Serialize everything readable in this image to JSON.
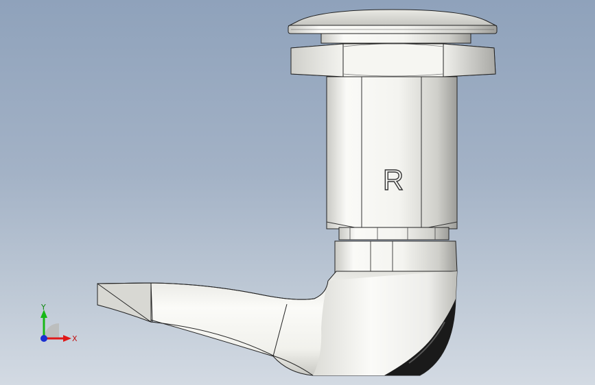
{
  "viewport": {
    "background_top": "#8fa2bb",
    "background_bottom": "#d3dae3"
  },
  "model": {
    "engraving": "R",
    "surface_color": "#f2f2ee",
    "shadow_color": "#9a9a96"
  },
  "triad": {
    "x_label": "X",
    "y_label": "Y",
    "x_color": "#e01818",
    "y_color": "#18b818",
    "z_color": "#1a2fd0"
  }
}
